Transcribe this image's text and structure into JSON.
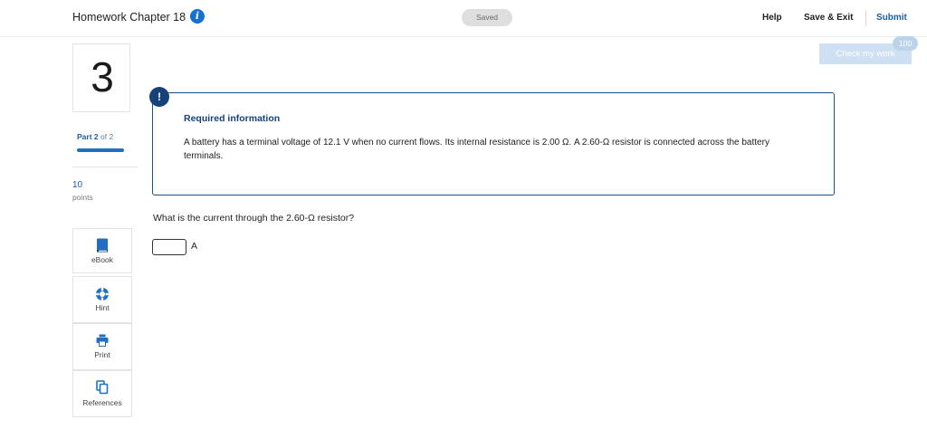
{
  "header": {
    "assignment_title": "Homework Chapter 18",
    "info_icon": "info-icon",
    "saved_status": "Saved",
    "help_label": "Help",
    "save_exit_label": "Save & Exit",
    "submit_label": "Submit"
  },
  "check_work": {
    "label": "Check my work",
    "badge": "100"
  },
  "question": {
    "number": "3",
    "part_prefix": "Part",
    "part_current": "2",
    "part_of": "of 2",
    "part_progress": 1.0,
    "points_value": "10",
    "points_label": "points"
  },
  "tools": [
    {
      "label": "eBook",
      "icon": "book-icon"
    },
    {
      "label": "Hint",
      "icon": "lifebuoy-icon"
    },
    {
      "label": "Print",
      "icon": "printer-icon"
    },
    {
      "label": "References",
      "icon": "copy-documents-icon"
    }
  ],
  "required_info": {
    "alert_symbol": "!",
    "heading": "Required information",
    "body": "A battery has a terminal voltage of 12.1 V when no current flows. Its internal resistance is 2.00 Ω. A 2.60-Ω resistor is connected across the battery terminals."
  },
  "prompt": {
    "text": "What is the current through the 2.60-Ω resistor?",
    "answer_value": "",
    "unit": "A"
  },
  "colors": {
    "accent": "#1a5fa6",
    "alert_navy": "#16427a",
    "progress_blue": "#1f6fc4",
    "check_button_bg": "#cfe0f2"
  }
}
